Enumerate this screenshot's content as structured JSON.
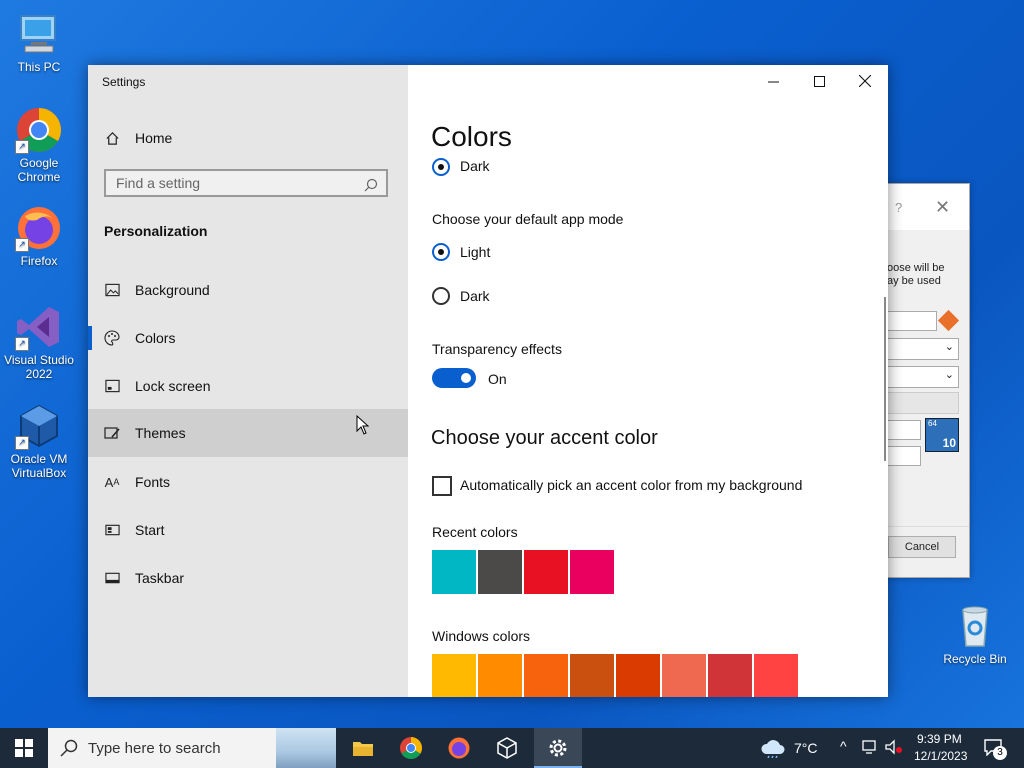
{
  "desktop": {
    "icons": [
      {
        "label": "This PC"
      },
      {
        "label": "Google Chrome"
      },
      {
        "label": "Firefox"
      },
      {
        "label": "Visual Studio 2022"
      },
      {
        "label": "Oracle VM VirtualBox"
      },
      {
        "label": "Recycle Bin"
      }
    ]
  },
  "background_dialog": {
    "help": "?",
    "text_line1": "oose will be",
    "text_line2": "ay be used",
    "cancel_label": "Cancel",
    "badge": "10",
    "badge_small": "64"
  },
  "settings": {
    "window_title": "Settings",
    "home_label": "Home",
    "search_placeholder": "Find a setting",
    "section_label": "Personalization",
    "nav_items": [
      {
        "label": "Background",
        "icon": "picture-icon"
      },
      {
        "label": "Colors",
        "icon": "palette-icon"
      },
      {
        "label": "Lock screen",
        "icon": "lock-screen-icon"
      },
      {
        "label": "Themes",
        "icon": "themes-icon"
      },
      {
        "label": "Fonts",
        "icon": "fonts-icon"
      },
      {
        "label": "Start",
        "icon": "start-icon"
      },
      {
        "label": "Taskbar",
        "icon": "taskbar-icon"
      }
    ],
    "selected_nav": "Colors",
    "hovered_nav": "Themes",
    "page_title": "Colors",
    "windows_mode_option_dark": "Dark",
    "app_mode_label": "Choose your default app mode",
    "app_mode_light": "Light",
    "app_mode_dark": "Dark",
    "app_mode_selected": "Light",
    "transparency_label": "Transparency effects",
    "transparency_state": "On",
    "accent_heading": "Choose your accent color",
    "auto_accent_label": "Automatically pick an accent color from my background",
    "auto_accent_checked": false,
    "recent_colors_label": "Recent colors",
    "recent_colors": [
      "#00b7c3",
      "#4c4a48",
      "#e81123",
      "#ea005e"
    ],
    "windows_colors_label": "Windows colors",
    "windows_colors": [
      "#ffb900",
      "#ff8c00",
      "#f7630c",
      "#ca5010",
      "#da3b01",
      "#ef6950",
      "#d13438",
      "#ff4343"
    ],
    "accent_color": "#0a5fcf"
  },
  "taskbar": {
    "search_placeholder": "Type here to search",
    "weather": "7°C",
    "time": "9:39 PM",
    "date": "12/1/2023",
    "notification_count": "3"
  }
}
